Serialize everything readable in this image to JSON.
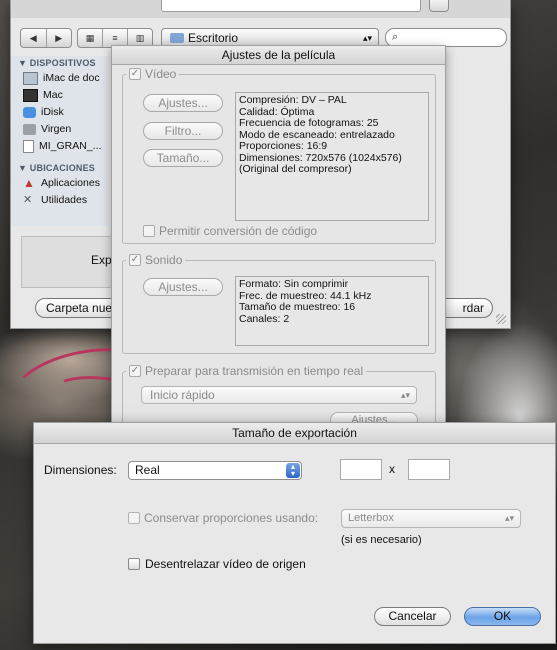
{
  "finder": {
    "nav_back": "◀",
    "nav_forward": "▶",
    "view_icons": "▦",
    "view_list": "≡",
    "view_columns": "▥",
    "location": "Escritorio",
    "search_placeholder": "",
    "sidebar": {
      "devices_header": "▼ DISPOSITIVOS",
      "devices": [
        {
          "label": "iMac de doc",
          "icon": "imac-icon"
        },
        {
          "label": "Mac",
          "icon": "display-icon"
        },
        {
          "label": "iDisk",
          "icon": "idisk-icon"
        },
        {
          "label": "Virgen",
          "icon": "disk-icon"
        },
        {
          "label": "MI_GRAN_...",
          "icon": "document-icon"
        }
      ],
      "places_header": "▼ UBICACIONES",
      "places": [
        {
          "label": "Aplicaciones",
          "icon": "applications-icon"
        },
        {
          "label": "Utilidades",
          "icon": "utilities-icon"
        }
      ]
    },
    "export_label_partial": "Exp",
    "new_folder_button": "Carpeta nueva",
    "save_button_partial": "rdar"
  },
  "movie_settings": {
    "title": "Ajustes de la película",
    "video": {
      "legend": "Vídeo",
      "checked": true,
      "settings_button": "Ajustes...",
      "filter_button": "Filtro...",
      "size_button": "Tamaño...",
      "info": [
        "Compresión: DV – PAL",
        "Calidad: Óptima",
        "Frecuencia de fotogramas: 25",
        "Modo de escaneado: entrelazado",
        "Proporciones: 16:9",
        "Dimensiones: 720x576 (1024x576)",
        "(Original del compresor)"
      ],
      "allow_transcoding": "Permitir conversión de código"
    },
    "sound": {
      "legend": "Sonido",
      "checked": true,
      "settings_button": "Ajustes...",
      "info": [
        "Formato: Sin comprimir",
        "Frec. de muestreo: 44.1 kHz",
        "Tamaño de muestreo: 16",
        "Canales: 2"
      ]
    },
    "streaming": {
      "label": "Preparar para transmisión en tiempo real",
      "checked": true,
      "option": "Inicio rápido",
      "settings_button": "Ajustes..."
    }
  },
  "export_size": {
    "title": "Tamaño de exportación",
    "dimensions_label": "Dimensiones:",
    "dimensions_value": "Real",
    "width_value": "",
    "height_value": "",
    "times": "x",
    "keep_aspect_label": "Conservar proporciones usando:",
    "keep_aspect_value": "Letterbox",
    "if_needed": "(si es necesario)",
    "deinterlace_label": "Desentrelazar vídeo de origen",
    "cancel_button": "Cancelar",
    "ok_button": "OK"
  },
  "colors": {
    "ok_button": "#6ca3e8",
    "selection_blue": "#2c68c8",
    "disabled_text": "#8b8b8b"
  }
}
